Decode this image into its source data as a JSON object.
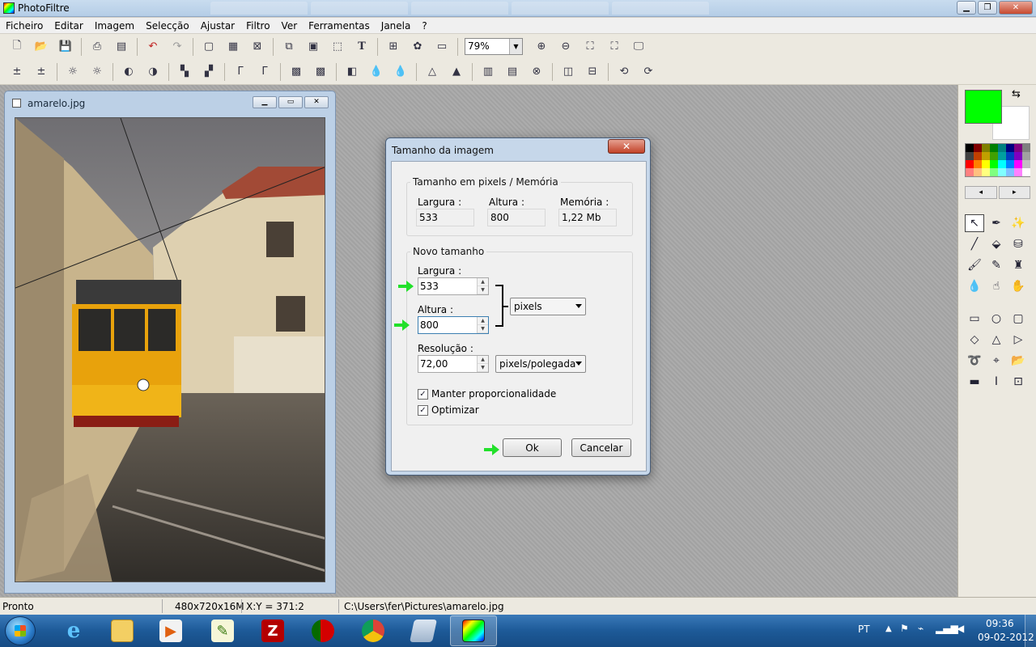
{
  "window": {
    "title": "PhotoFiltre"
  },
  "menu": [
    "Ficheiro",
    "Editar",
    "Imagem",
    "Selecção",
    "Ajustar",
    "Filtro",
    "Ver",
    "Ferramentas",
    "Janela",
    "?"
  ],
  "toolbar": {
    "zoom_value": "79%"
  },
  "image_window": {
    "filename": "amarelo.jpg"
  },
  "dialog": {
    "title": "Tamanho da imagem",
    "close_label": "✕",
    "current_group": {
      "legend": "Tamanho em pixels / Memória",
      "width_label": "Largura :",
      "width_value": "533",
      "height_label": "Altura :",
      "height_value": "800",
      "memory_label": "Memória :",
      "memory_value": "1,22 Mb"
    },
    "new_group": {
      "legend": "Novo tamanho",
      "width_label": "Largura :",
      "width_value": "533",
      "height_label": "Altura :",
      "height_value": "800",
      "unit_value": "pixels",
      "resolution_label": "Resolução :",
      "resolution_value": "72,00",
      "resolution_unit_value": "pixels/polegada",
      "keep_ratio_label": "Manter proporcionalidade",
      "keep_ratio_checked": true,
      "optimize_label": "Optimizar",
      "optimize_checked": true
    },
    "ok_label": "Ok",
    "cancel_label": "Cancelar"
  },
  "statusbar": {
    "state": "Pronto",
    "image_info": "480x720x16M",
    "cursor": "X:Y = 371:2",
    "path": "C:\\Users\\fer\\Pictures\\amarelo.jpg"
  },
  "taskbar": {
    "language": "PT",
    "time": "09:36",
    "date": "09-02-2012"
  },
  "colors": {
    "foreground": "#00ff00",
    "background": "#ffffff",
    "annotation_arrow": "#22e02a"
  }
}
